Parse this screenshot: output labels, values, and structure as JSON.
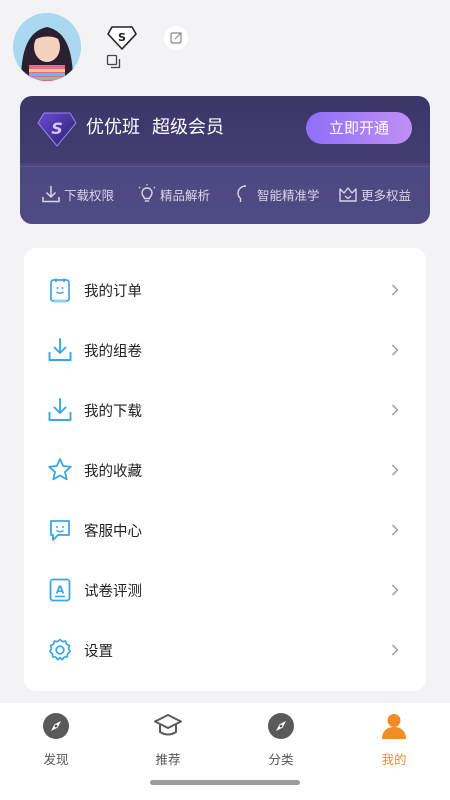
{
  "profile": {
    "avatar_icon": "anime-girl-avatar",
    "vip_level_icon": "diamond-s-icon",
    "edit_icon": "edit-icon",
    "copy_icon": "copy-icon"
  },
  "vip_card": {
    "brand": "优优班",
    "title": "超级会员",
    "open_button": "立即开通",
    "benefits": [
      {
        "label": "下载权限",
        "icon": "download-icon"
      },
      {
        "label": "精品解析",
        "icon": "lightbulb-icon"
      },
      {
        "label": "智能精准学",
        "icon": "head-profile-icon"
      },
      {
        "label": "更多权益",
        "icon": "crown-icon"
      }
    ],
    "colors": {
      "card_top": "#3b3568",
      "card_bottom": "#4f4b82",
      "button_start": "#8f6ff6",
      "button_end": "#c08ff5"
    }
  },
  "menu": {
    "items": [
      {
        "label": "我的订单",
        "icon": "order-clipboard-icon"
      },
      {
        "label": "我的组卷",
        "icon": "download-tray-icon"
      },
      {
        "label": "我的下载",
        "icon": "download-tray-icon"
      },
      {
        "label": "我的收藏",
        "icon": "star-icon"
      },
      {
        "label": "客服中心",
        "icon": "chat-bubble-icon"
      },
      {
        "label": "试卷评测",
        "icon": "exam-paper-icon"
      },
      {
        "label": "设置",
        "icon": "gear-icon"
      }
    ],
    "accent": "#3aa6e8"
  },
  "bottom_nav": {
    "items": [
      {
        "label": "发现",
        "icon": "compass-icon",
        "active": false
      },
      {
        "label": "推荐",
        "icon": "graduation-cap-icon",
        "active": false
      },
      {
        "label": "分类",
        "icon": "compass-icon",
        "active": false
      },
      {
        "label": "我的",
        "icon": "person-icon",
        "active": true
      }
    ],
    "active_color": "#f28c28",
    "inactive_color": "#555555"
  }
}
